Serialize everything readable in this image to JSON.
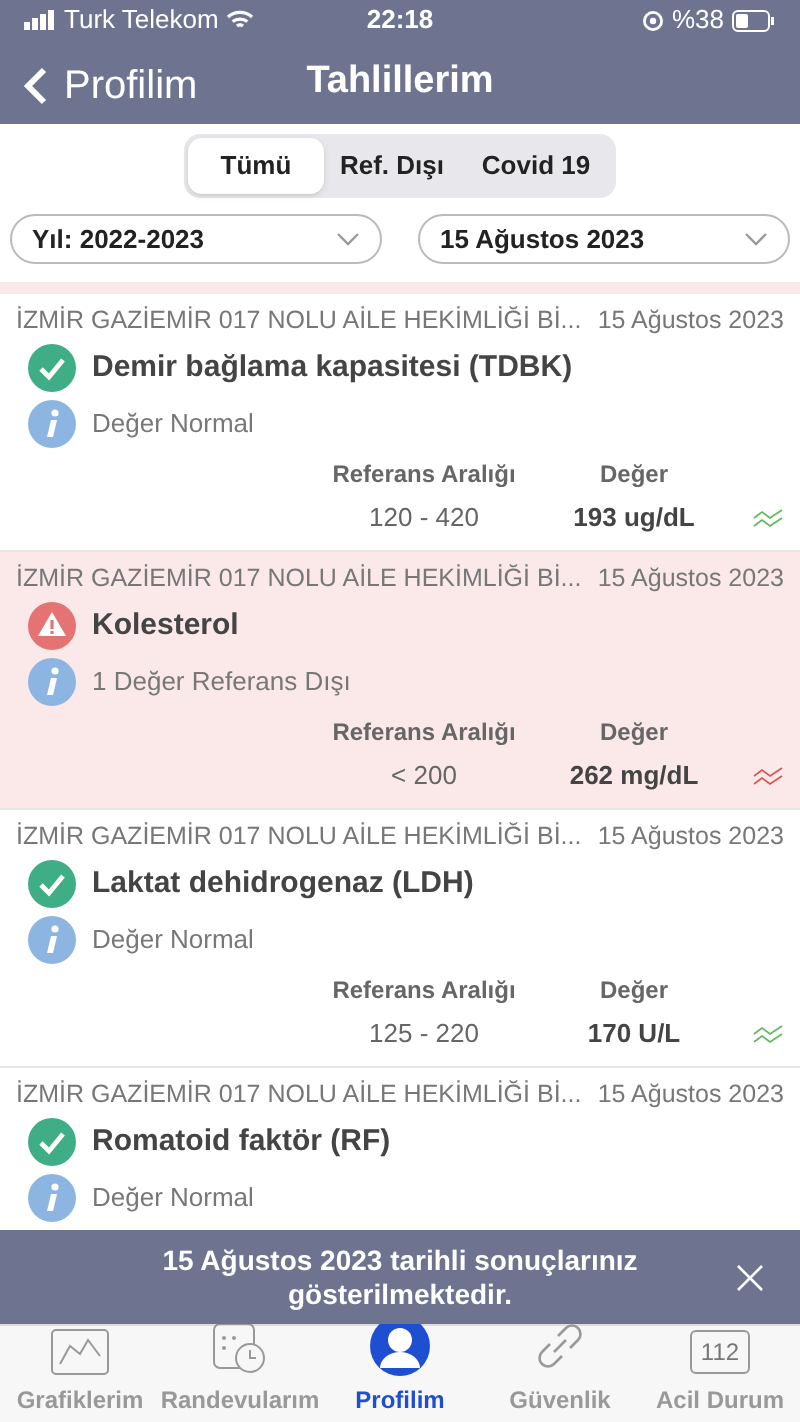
{
  "status_bar": {
    "carrier": "Turk Telekom",
    "time": "22:18",
    "battery": "%38"
  },
  "nav": {
    "back": "Profilim",
    "title": "Tahlillerim"
  },
  "segments": [
    {
      "label": "Tümü",
      "selected": true
    },
    {
      "label": "Ref. Dışı",
      "selected": false
    },
    {
      "label": "Covid 19",
      "selected": false
    }
  ],
  "filters": [
    {
      "value": "Yıl: 2022-2023"
    },
    {
      "value": "15 Ağustos 2023"
    }
  ],
  "results": [
    {
      "institution": "İZMİR GAZİEMİR 017 NOLU AİLE HEKİMLİĞİ Bİ...",
      "date": "15 Ağustos 2023",
      "out_of_range": false,
      "test": "Demir bağlama kapasitesi (TDBK)",
      "note": "Değer Normal",
      "reference_label": "Referans Aralığı",
      "value_label": "Değer",
      "reference": "120 - 420",
      "value": "193 ug/dL"
    },
    {
      "institution": "İZMİR GAZİEMİR 017 NOLU AİLE HEKİMLİĞİ Bİ...",
      "date": "15 Ağustos 2023",
      "out_of_range": true,
      "test": "Kolesterol",
      "note": "1 Değer Referans Dışı",
      "reference_label": "Referans Aralığı",
      "value_label": "Değer",
      "reference": "< 200",
      "value": "262 mg/dL"
    },
    {
      "institution": "İZMİR GAZİEMİR 017 NOLU AİLE HEKİMLİĞİ Bİ...",
      "date": "15 Ağustos 2023",
      "out_of_range": false,
      "test": "Laktat dehidrogenaz (LDH)",
      "note": "Değer Normal",
      "reference_label": "Referans Aralığı",
      "value_label": "Değer",
      "reference": "125 - 220",
      "value": "170 U/L"
    },
    {
      "institution": "İZMİR GAZİEMİR 017 NOLU AİLE HEKİMLİĞİ Bİ...",
      "date": "15 Ağustos 2023",
      "out_of_range": false,
      "test": "Romatoid faktör (RF)",
      "note": "Değer Normal"
    }
  ],
  "toast": "15 Ağustos 2023 tarihli sonuçlarınız gösterilmektedir.",
  "tab_bar": [
    {
      "label": "Grafiklerim",
      "kind": "chart",
      "selected": false
    },
    {
      "label": "Randevularım",
      "kind": "calendar",
      "selected": false
    },
    {
      "label": "Profilim",
      "kind": "profile",
      "selected": true
    },
    {
      "label": "Güvenlik",
      "kind": "link",
      "selected": false
    },
    {
      "label": "Acil Durum",
      "kind": "emergency",
      "badge": "112",
      "selected": false
    }
  ]
}
